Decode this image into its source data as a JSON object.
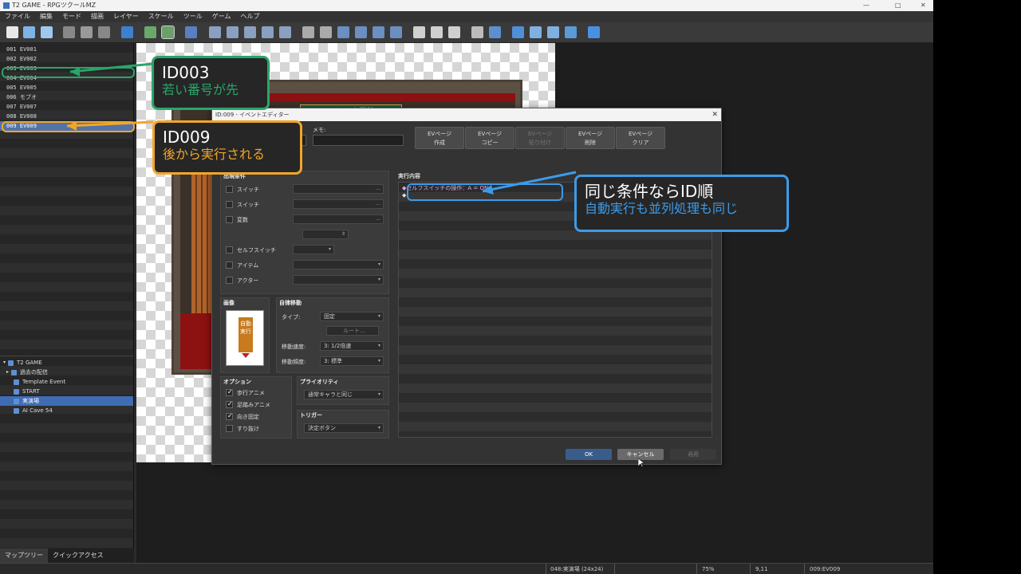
{
  "app": {
    "title": "T2 GAME - RPGツクールMZ",
    "window_controls": {
      "minimize": "—",
      "maximize": "□",
      "close": "✕"
    }
  },
  "menu": [
    "ファイル",
    "編集",
    "モード",
    "描画",
    "レイヤー",
    "スケール",
    "ツール",
    "ゲーム",
    "ヘルプ"
  ],
  "events": [
    {
      "id": "001",
      "name": "EV001"
    },
    {
      "id": "002",
      "name": "EV002"
    },
    {
      "id": "003",
      "name": "EV003"
    },
    {
      "id": "004",
      "name": "EV004"
    },
    {
      "id": "005",
      "name": "EV005"
    },
    {
      "id": "006",
      "name": "モブオ"
    },
    {
      "id": "007",
      "name": "EV007"
    },
    {
      "id": "008",
      "name": "EV008"
    },
    {
      "id": "009",
      "name": "EV009"
    }
  ],
  "map_tree": {
    "root": "T2 GAME",
    "items": [
      "過去の配信",
      "Template Event",
      "START",
      "実演場",
      "AI Cave 54"
    ]
  },
  "bottom_tabs": [
    "マップツリー",
    "クイックアクセス"
  ],
  "map": {
    "sign": "みなみ大冒険"
  },
  "status": {
    "map": "048:実演場 (24x24)",
    "zoom": "75%",
    "coords": "9,11",
    "event": "009:EV009"
  },
  "dialog": {
    "title": "ID:009 - イベントエディター",
    "close": "✕",
    "memo_label": "メモ:",
    "ev_buttons": [
      {
        "l1": "EVページ",
        "l2": "作成"
      },
      {
        "l1": "EVページ",
        "l2": "コピー"
      },
      {
        "l1": "EVページ",
        "l2": "貼り付け"
      },
      {
        "l1": "EVページ",
        "l2": "削除"
      },
      {
        "l1": "EVページ",
        "l2": "クリア"
      }
    ],
    "conditions": {
      "title": "出現条件",
      "items": [
        "スイッチ",
        "スイッチ",
        "変数",
        "セルフスイッチ",
        "アイテム",
        "アクター"
      ],
      "dots": "…"
    },
    "image": {
      "title": "画像",
      "sprite_text": "自動実行"
    },
    "autonomous": {
      "title": "自律移動",
      "type_label": "タイプ:",
      "type_value": "固定",
      "route_button": "ルート...",
      "speed_label": "移動速度:",
      "speed_value": "3: 1/2倍速",
      "freq_label": "移動頻度:",
      "freq_value": "3: 標準"
    },
    "options": {
      "title": "オプション",
      "items": [
        {
          "label": "歩行アニメ",
          "checked": true
        },
        {
          "label": "足踏みアニメ",
          "checked": true
        },
        {
          "label": "向き固定",
          "checked": true
        },
        {
          "label": "すり抜け",
          "checked": false
        }
      ]
    },
    "priority": {
      "title": "プライオリティ",
      "value": "通常キャラと同じ"
    },
    "trigger": {
      "title": "トリガー",
      "value": "決定ボタン"
    },
    "exec": {
      "title": "実行内容",
      "line1": "◆セルフスイッチの操作：A = ON",
      "line2": "◆"
    },
    "buttons": {
      "ok": "OK",
      "cancel": "キャンセル",
      "apply": "適用"
    }
  },
  "annotations": {
    "a1": {
      "big": "ID003",
      "small": "若い番号が先"
    },
    "a2": {
      "big": "ID009",
      "small": "後から実行される"
    },
    "a3": {
      "big": "同じ条件ならID順",
      "small": "自動実行も並列処理も同じ"
    }
  },
  "colors": {
    "green": "#2aa56a",
    "orange": "#f2a62a",
    "blue": "#3d9be9"
  }
}
